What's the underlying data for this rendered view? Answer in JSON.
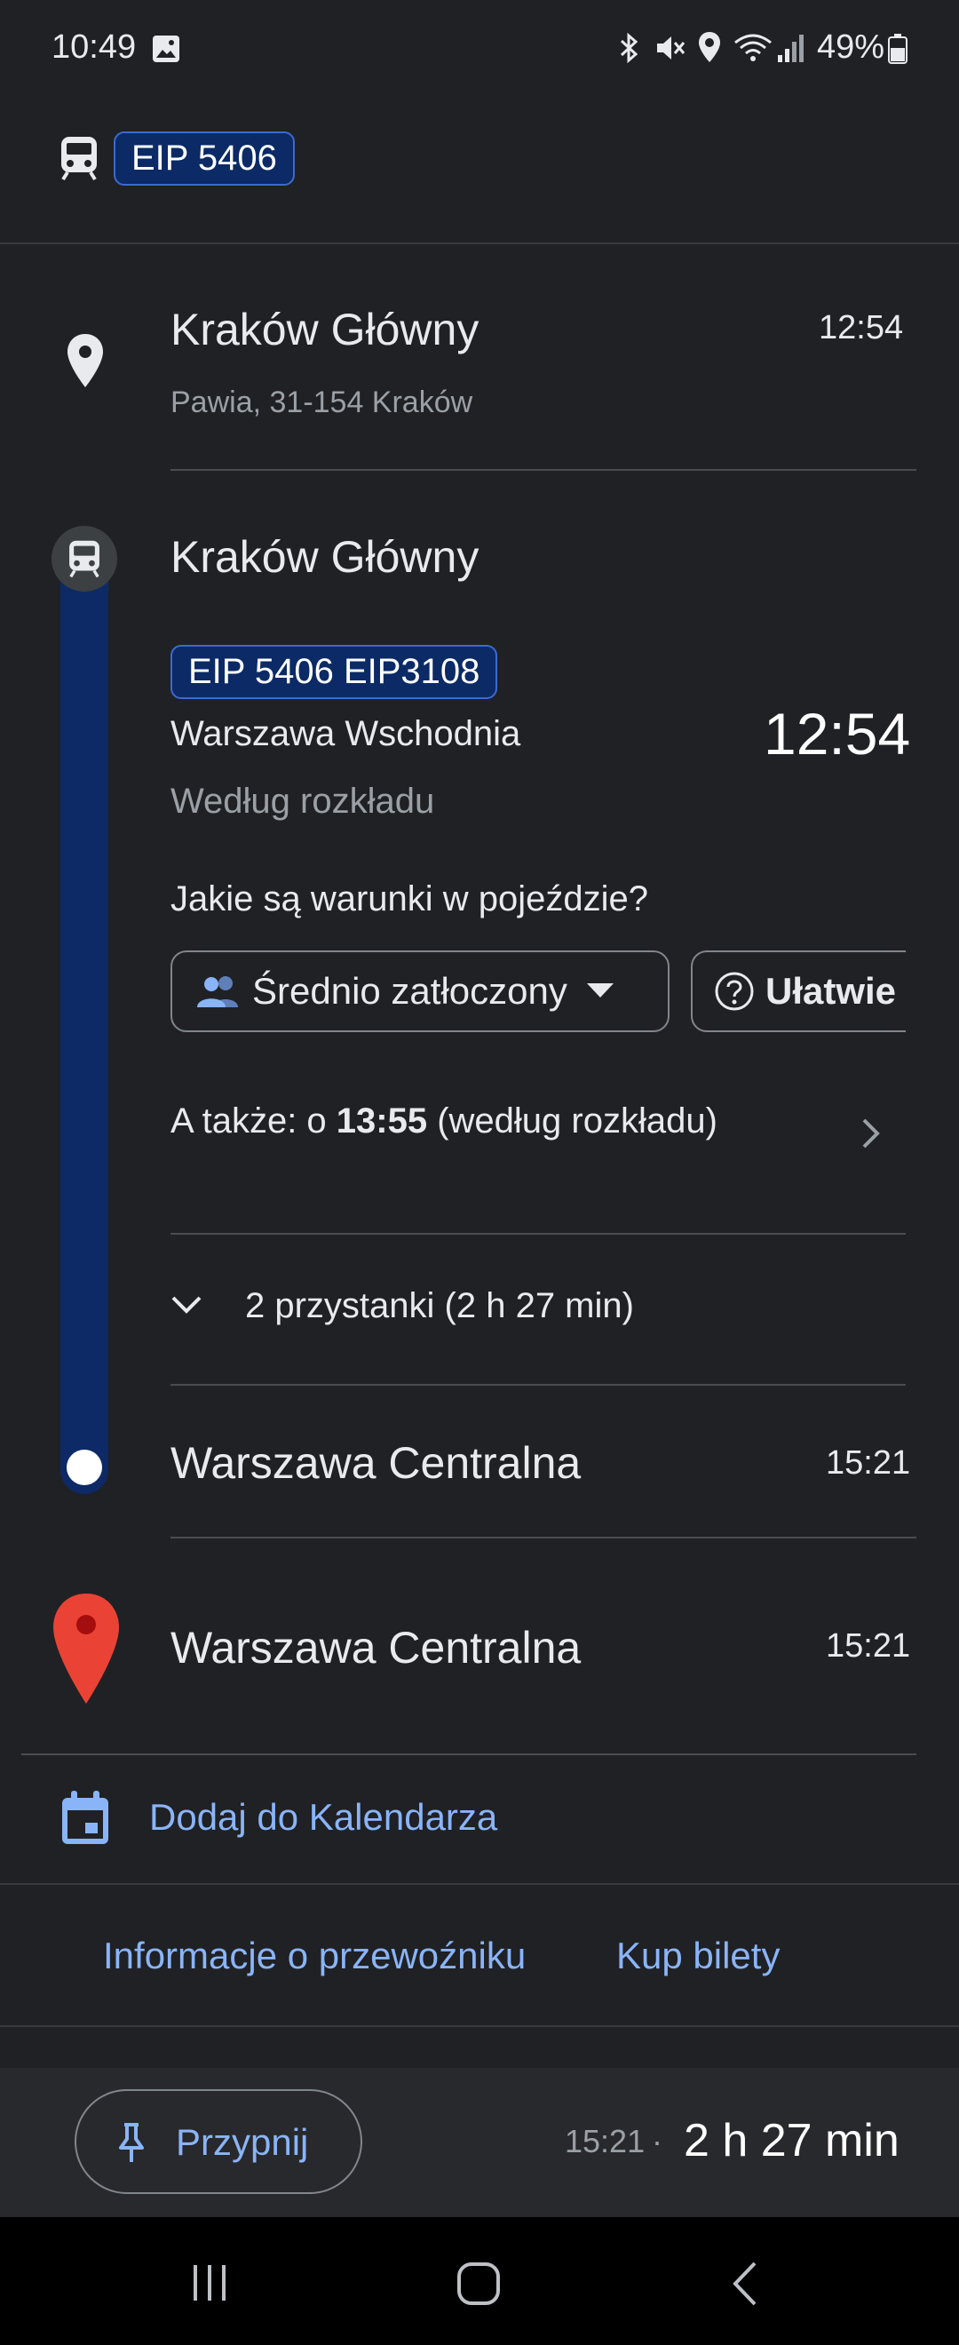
{
  "status_bar": {
    "time": "10:49",
    "battery": "49%"
  },
  "header": {
    "route_badge": "EIP 5406",
    "icon": "train-icon"
  },
  "origin": {
    "name": "Kraków Główny",
    "address": "Pawia, 31-154 Kraków",
    "time": "12:54",
    "icon": "place-pin-icon"
  },
  "departure": {
    "station": "Kraków Główny",
    "badge": "EIP 5406 EIP3108",
    "headsign": "Warszawa Wschodnia",
    "time": "12:54",
    "schedule_status": "Według rozkładu",
    "conditions_question": "Jakie są warunki w pojeździe?",
    "crowding_chip": "Średnio zatłoczony",
    "accessibility_chip": "Ułatwie",
    "also_prefix": "A także: o ",
    "also_time": "13:55",
    "also_suffix": " (według rozkładu)",
    "stops_summary": "2 przystanki (2 h 27 min)",
    "line_color": "#0d2a66"
  },
  "arrival": {
    "name": "Warszawa Centralna",
    "time": "15:21"
  },
  "destination": {
    "name": "Warszawa Centralna",
    "time": "15:21",
    "icon": "red-map-pin-icon"
  },
  "actions": {
    "add_calendar": "Dodaj do Kalendarza",
    "operator_info": "Informacje o przewoźniku",
    "buy_tickets": "Kup bilety"
  },
  "bottom_bar": {
    "pin_label": "Przypnij",
    "arrival_time": "15:21",
    "separator": "·",
    "duration": "2 h 27 min"
  },
  "accent_color": "#8ab4f8"
}
